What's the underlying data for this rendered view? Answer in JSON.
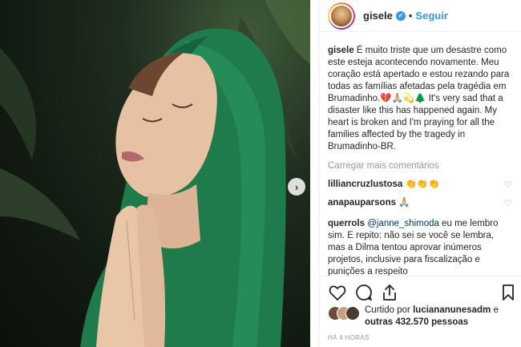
{
  "post": {
    "author": "gisele",
    "follow_label": "Seguir",
    "separator": "•",
    "verified_icon": "verified-badge-icon",
    "caption_user": "gisele",
    "caption_text": "É muito triste que um desastre como este esteja acontecendo novamente. Meu coração está apertado e estou rezando para todas as famílias afetadas pela tragédia em Brumadinho.💔🙏🏼💫🌲 It's very sad that a disaster like this has happened again. My heart is broken and I'm praying for all the families affected by the tragedy in Brumadinho-BR.",
    "load_more": "Carregar mais comentários",
    "comments": [
      {
        "user": "lilliancruzlustosa",
        "text": "👏👏👏"
      },
      {
        "user": "anapauparsons",
        "text": "🙏🏼"
      },
      {
        "user": "querrols",
        "mention": "@janne_shimoda",
        "text": " eu me lembro sim. E repito: não sei se você se lembra, mas a Dilma tentou aprovar inúmeros projetos, inclusive para fiscalização e punições a respeito"
      }
    ],
    "likes_prefix": "Curtido por",
    "likes_user": "luciananunesadm",
    "likes_join": "e",
    "likes_others_prefix": "outras",
    "likes_count": "432.570",
    "likes_suffix": "pessoas",
    "timestamp": "HÁ 4 HORAS"
  },
  "icons": {
    "like": "heart-icon",
    "comment": "comment-icon",
    "share": "share-icon",
    "save": "bookmark-icon",
    "next": "chevron-right-icon"
  }
}
